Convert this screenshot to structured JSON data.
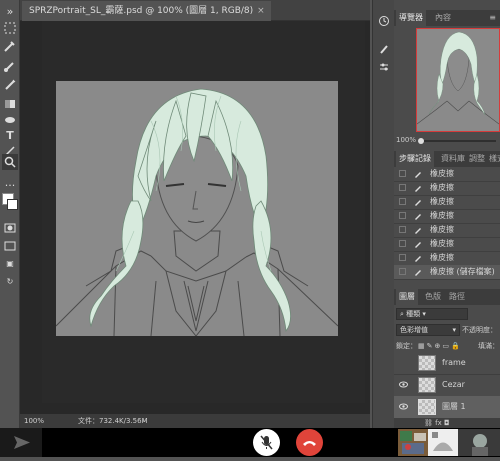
{
  "document": {
    "tab_title": "SPRZPortrait_SL_霸薩.psd @ 100% (圖層 1, RGB/8)",
    "close_glyph": "×"
  },
  "status": {
    "zoom": "100%",
    "doc_info": "文件：732.4K/3.56M"
  },
  "navigator": {
    "tabs": [
      "導覽器",
      "內容"
    ],
    "zoom": "100%"
  },
  "history": {
    "tabs": [
      "步驟記錄",
      "資料庫",
      "調整",
      "樣式"
    ],
    "items": [
      "橡皮擦",
      "橡皮擦",
      "橡皮擦",
      "橡皮擦",
      "橡皮擦",
      "橡皮擦",
      "橡皮擦",
      "橡皮擦 (儲存檔案)"
    ]
  },
  "layers": {
    "tabs": [
      "圖層",
      "色版",
      "路徑"
    ],
    "filter_kind": "種類",
    "blend_mode": "色彩增值",
    "opacity_label": "不透明度：",
    "lock_label": "鎖定：",
    "fill_label": "填滿：",
    "items": [
      {
        "name": "frame",
        "visible": false
      },
      {
        "name": "Cezar",
        "visible": true
      },
      {
        "name": "圖層 1",
        "visible": true
      }
    ],
    "bottom_icons": "fx"
  },
  "colors": {
    "accent_red": "#e0443a",
    "hair": "#d7eadd",
    "canvas": "#8a8a8a"
  }
}
